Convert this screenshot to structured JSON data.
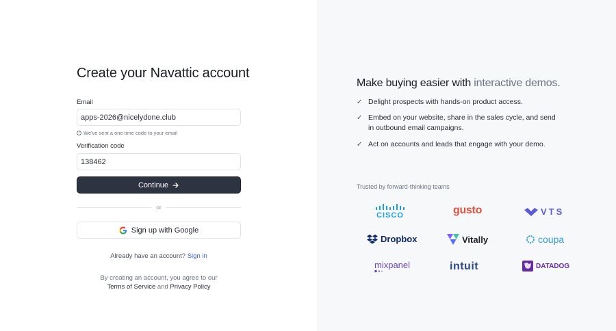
{
  "signup": {
    "title": "Create your Navattic account",
    "email_label": "Email",
    "email_value": "apps-2026@nicelydone.club",
    "email_hint": "We've sent a one time code to your email",
    "code_label": "Verification code",
    "code_value": "138462",
    "continue_label": "Continue",
    "or_label": "or",
    "google_label": "Sign up with Google",
    "account_prompt": "Already have an account?",
    "signin_link": "Sign in",
    "legal_prefix": "By creating an account, you agree to our",
    "terms_link": "Terms of Service",
    "legal_and": "and",
    "privacy_link": "Privacy Policy"
  },
  "promo": {
    "title_main": "Make buying easier with",
    "title_accent": "interactive demos.",
    "bullets": [
      "Delight prospects with hands-on product access.",
      "Embed on your website, share in the sales cycle, and send in outbound email campaigns.",
      "Act on accounts and leads that engage with your demo."
    ],
    "trusted_label": "Trusted by forward-thinking teams",
    "logos": {
      "cisco": "CISCO",
      "gusto": "gusto",
      "vts": "VTS",
      "dropbox": "Dropbox",
      "vitally": "Vitally",
      "coupa": "coupa",
      "mixpanel": "mixpanel",
      "intuit": "intuit",
      "datadog": "DATADOG"
    }
  },
  "colors": {
    "primary_button": "#2d3340",
    "link": "#3b5bdb",
    "gusto": "#e0533e",
    "vts": "#5b5bd6",
    "dropbox": "#0f2a6b",
    "coupa": "#2f9fd8",
    "mixpanel": "#6b46c1",
    "intuit": "#2a4a8a",
    "datadog": "#632ca6",
    "cisco": "#1ba0d7"
  }
}
